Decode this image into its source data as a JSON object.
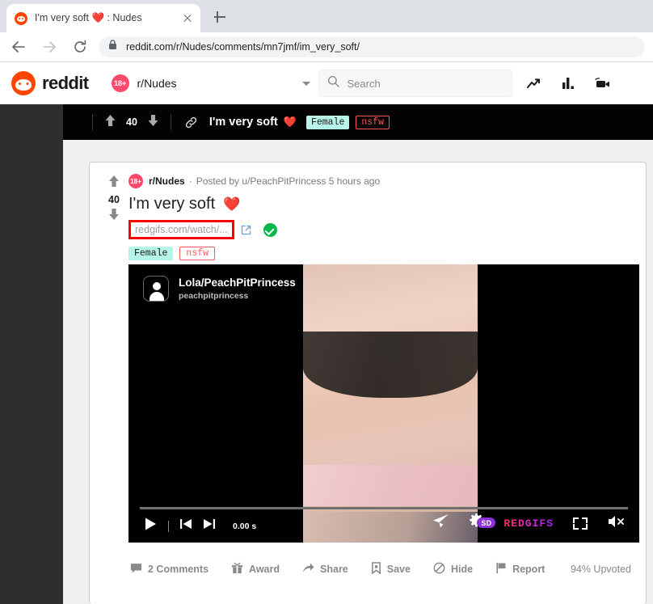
{
  "browser": {
    "tab": {
      "title": "I'm very soft ❤️ : Nudes",
      "favicon": "reddit-favicon",
      "close_label": "×"
    },
    "new_tab_label": "+",
    "url": "reddit.com/r/Nudes/comments/mn7jmf/im_very_soft/",
    "back_label": "Back",
    "forward_label": "Forward",
    "reload_label": "Reload",
    "lock_label": "Secure"
  },
  "reddit_header": {
    "logo_text": "reddit",
    "subreddit_badge": "18+",
    "subreddit_name": "r/Nudes",
    "search_placeholder": "Search",
    "search_value": "",
    "icons": [
      "trending-icon",
      "bar-chart-icon",
      "live-video-icon"
    ]
  },
  "sticky_bar": {
    "score": "40",
    "title": "I'm very soft",
    "heart": "❤️",
    "flair_female": "Female",
    "flair_nsfw": "nsfw",
    "upvote_label": "Upvote",
    "downvote_label": "Downvote",
    "link_label": "Permalink"
  },
  "post": {
    "score": "40",
    "subreddit_badge": "18+",
    "subreddit": "r/Nudes",
    "separator": "·",
    "posted_by": "Posted by u/PeachPitPrincess 5 hours ago",
    "title": "I'm very soft",
    "heart": "❤️",
    "link_url": "redgifs.com/watch/...",
    "flair_female": "Female",
    "flair_nsfw": "nsfw",
    "upvote_label": "Upvote",
    "downvote_label": "Downvote",
    "annotation_color": "#ff0000",
    "verified_color": "#00b84c"
  },
  "player": {
    "author_name": "Lola/PeachPitPrincess",
    "author_handle": "peachpitprincess",
    "time": "0.00 s",
    "quality": "SD",
    "quality_badge_color": "#8b2fd6",
    "brand": "REDGIFS",
    "brand_color": "#e0308e",
    "play_label": "Play",
    "prev_label": "Previous frame",
    "next_label": "Next frame",
    "share_label": "Share",
    "settings_label": "Quality settings",
    "fullscreen_label": "Fullscreen",
    "mute_label": "Muted"
  },
  "actions": {
    "comments": "2 Comments",
    "award": "Award",
    "share": "Share",
    "save": "Save",
    "hide": "Hide",
    "report": "Report",
    "upvoted": "94% Upvoted"
  },
  "colors": {
    "reddit_orange": "#ff4500",
    "dark_bar": "#030303",
    "page_bg": "#edeff1",
    "muted_text": "#878a8c"
  }
}
